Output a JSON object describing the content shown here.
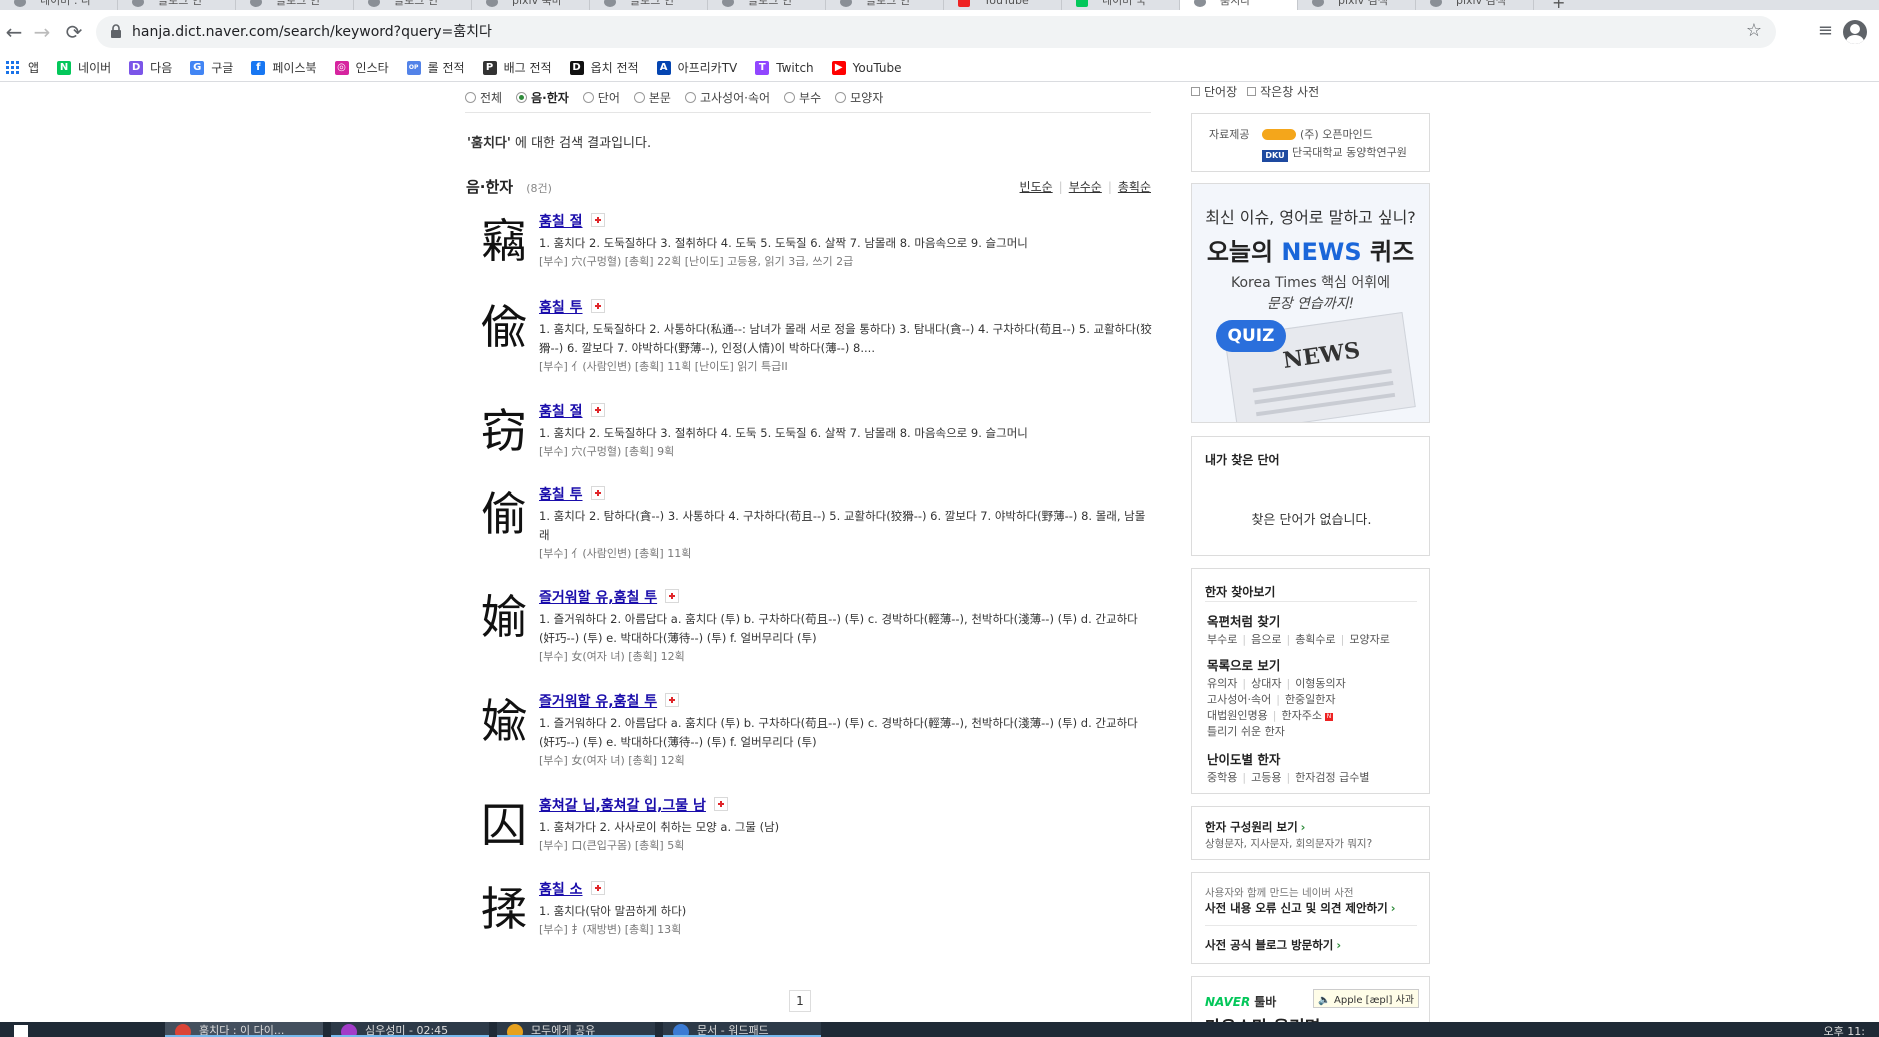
{
  "browser": {
    "tabs": [
      {
        "title": "네이버 : 나",
        "state": "normal"
      },
      {
        "title": "블로그 인",
        "state": "normal"
      },
      {
        "title": "블로그 인",
        "state": "normal"
      },
      {
        "title": "블로그 인",
        "state": "normal"
      },
      {
        "title": "pixiv 북마",
        "state": "normal"
      },
      {
        "title": "블로그 인",
        "state": "normal"
      },
      {
        "title": "블로그 인",
        "state": "normal"
      },
      {
        "title": "블로그 인",
        "state": "normal"
      },
      {
        "title": "YouTube",
        "state": "red"
      },
      {
        "title": "네이버 국",
        "state": "green"
      },
      {
        "title": "훔치다",
        "state": "active"
      },
      {
        "title": "pixiv 검색",
        "state": "normal"
      },
      {
        "title": "pixiv 검색",
        "state": "normal"
      }
    ],
    "url": "hanja.dict.naver.com/search/keyword?query=훔치다",
    "bookmarks": [
      {
        "label": "앱",
        "icon": "apps-grid-icon",
        "color": "#1a73e8"
      },
      {
        "label": "네이버",
        "icon": "naver-icon",
        "color": "#03c75a",
        "glyph": "N"
      },
      {
        "label": "다음",
        "icon": "daum-icon",
        "color": "#7b55e8",
        "glyph": "D"
      },
      {
        "label": "구글",
        "icon": "google-icon",
        "color": "#4285f4",
        "glyph": "G"
      },
      {
        "label": "페이스북",
        "icon": "facebook-icon",
        "color": "#1877f2",
        "glyph": "f"
      },
      {
        "label": "인스타",
        "icon": "instagram-icon",
        "color": "#d6249f",
        "glyph": "◎"
      },
      {
        "label": "롤 전적",
        "icon": "op-gg-icon",
        "color": "#5383e8",
        "glyph": "OP"
      },
      {
        "label": "배그 전적",
        "icon": "pubg-icon",
        "color": "#333333",
        "glyph": "P"
      },
      {
        "label": "옵치 전적",
        "icon": "overwatch-icon",
        "color": "#111111",
        "glyph": "D"
      },
      {
        "label": "아프리카TV",
        "icon": "afreecatv-icon",
        "color": "#0545b1",
        "glyph": "A"
      },
      {
        "label": "Twitch",
        "icon": "twitch-icon",
        "color": "#9146ff",
        "glyph": "T"
      },
      {
        "label": "YouTube",
        "icon": "youtube-icon",
        "color": "#ff0000",
        "glyph": "▶"
      }
    ]
  },
  "filters": [
    {
      "label": "전체",
      "selected": false
    },
    {
      "label": "음·한자",
      "selected": true
    },
    {
      "label": "단어",
      "selected": false
    },
    {
      "label": "본문",
      "selected": false
    },
    {
      "label": "고사성어·속어",
      "selected": false
    },
    {
      "label": "부수",
      "selected": false
    },
    {
      "label": "모양자",
      "selected": false
    }
  ],
  "summary": {
    "query": "'훔치다'",
    "suffix": " 에 대한 검색 결과입니다."
  },
  "section": {
    "title": "음·한자",
    "count": "(8건)",
    "sorts": [
      "빈도순",
      "부수순",
      "총획순"
    ]
  },
  "entries": [
    {
      "char": "竊",
      "head": "훔칠 절",
      "mean": "1. 훔치다 2. 도둑질하다 3. 절취하다 4. 도둑 5. 도둑질 6. 살짝 7. 남몰래 8. 마음속으로 9. 슬그머니",
      "meta": "[부수] 穴(구멍혈)  [총획] 22획  [난이도] 고등용, 읽기 3급, 쓰기 2급"
    },
    {
      "char": "偸",
      "head": "훔칠 투",
      "mean": "1. 훔치다, 도둑질하다 2. 사통하다(私通--: 남녀가 몰래 서로 정을 통하다) 3. 탐내다(貪--) 4. 구차하다(苟且--) 5. 교활하다(狡猾--) 6. 깔보다 7. 야박하다(野薄--), 인정(人情)이 박하다(薄--) 8....",
      "meta": "[부수] 亻(사람인변)  [총획] 11획  [난이도] 읽기 특급II"
    },
    {
      "char": "窃",
      "head": "훔칠 절",
      "mean": "1. 훔치다 2. 도둑질하다 3. 절취하다 4. 도둑 5. 도둑질 6. 살짝 7. 남몰래 8. 마음속으로 9. 슬그머니",
      "meta": "[부수] 穴(구멍혈)  [총획] 9획"
    },
    {
      "char": "偷",
      "head": "훔칠 투",
      "mean": "1. 훔치다 2. 탐하다(貪--) 3. 사통하다 4. 구차하다(苟且--) 5. 교활하다(狡猾--) 6. 깔보다 7. 야박하다(野薄--) 8. 몰래, 남몰래",
      "meta": "[부수] 亻(사람인변)  [총획] 11획"
    },
    {
      "char": "媮",
      "head": "즐거워할 유,훔칠 투",
      "mean": "1. 즐거워하다 2. 아름답다 a. 훔치다 (투) b. 구차하다(苟且--) (투) c. 경박하다(輕薄--), 천박하다(淺薄--) (투) d. 간교하다(奸巧--) (투) e. 박대하다(薄待--) (투) f. 얼버무리다 (투)",
      "meta": "[부수] 女(여자 녀)  [총획] 12획"
    },
    {
      "char": "婾",
      "head": "즐거워할 유,훔칠 투",
      "mean": "1. 즐거워하다 2. 아름답다 a. 훔치다 (투) b. 구차하다(苟且--) (투) c. 경박하다(輕薄--), 천박하다(淺薄--) (투) d. 간교하다(奸巧--) (투) e. 박대하다(薄待--) (투) f. 얼버무리다 (투)",
      "meta": "[부수] 女(여자 녀)  [총획] 12획"
    },
    {
      "char": "囚",
      "head": "훔쳐갈 닙,훔쳐갈 입,그물 남",
      "mean": "1. 훔쳐가다 2. 사사로이 취하는 모양 a. 그물 (남)",
      "meta": "[부수] 口(큰입구몸)  [총획] 5획"
    },
    {
      "char": "揉",
      "head": "훔칠 소",
      "mean": "1. 훔치다(닦아 말끔하게 하다)",
      "meta": "[부수] 扌(재방변)  [총획] 13획"
    }
  ],
  "pager": {
    "current": "1"
  },
  "right": {
    "top_links": [
      "단어장",
      "작은창 사전"
    ],
    "provider": {
      "label": "자료제공",
      "p1": "(주) 오픈마인드",
      "p1_logo": "hanja",
      "p2": "단국대학교 동양학연구원",
      "p2_logo": "DKU"
    },
    "ad": {
      "line1": "최신 이슈, 영어로 말하고 싶니?",
      "line2a": "오늘의 ",
      "line2b": "NEWS",
      "line2c": " 퀴즈",
      "line3": "Korea Times 핵심 어휘에",
      "line4": "문장 연습까지!",
      "quiz": "QUIZ",
      "paper": "NEWS"
    },
    "recent": {
      "title": "내가 찾은 단어",
      "empty": "찾은 단어가 없습니다."
    },
    "finder": {
      "title": "한자 찾아보기",
      "g1": {
        "title": "옥편처럼 찾기",
        "items": [
          "부수로",
          "음으로",
          "총획수로",
          "모양자로"
        ]
      },
      "g2": {
        "title": "목록으로 보기",
        "row1": [
          "유의자",
          "상대자",
          "이형동의자"
        ],
        "row2": [
          "고사성어·속어",
          "한중일한자"
        ],
        "row3": [
          "대법원인명용",
          "한자주소"
        ],
        "row4": [
          "틀리기 쉬운 한자"
        ],
        "new": "N"
      },
      "g3": {
        "title": "난이도별 한자",
        "items": [
          "중학용",
          "고등용",
          "한자검정 급수별"
        ]
      }
    },
    "principle": {
      "title": "한자 구성원리 보기",
      "desc": "상형문자, 지사문자, 회의문자가 뭐지?"
    },
    "report": {
      "small": "사용자와 함께 만드는 네이버 사전",
      "link1": "사전 내용 오류 신고 및 의견 제안하기",
      "link2": "사전 공식 블로그 방문하기"
    },
    "toolbar_ad": {
      "brand": "NAVER",
      "label": "툴바",
      "headline": "마우스만 올리면",
      "tip": "🔈 Apple [æpl] 사과"
    }
  },
  "taskbar": {
    "items": [
      {
        "title": "훔치다 : 이 다이...",
        "color": "#db4437"
      },
      {
        "title": "심우성미 - 02:45",
        "color": "#a23cc9"
      },
      {
        "title": "모두에게 공유",
        "color": "#e6a11e"
      },
      {
        "title": "문서 - 워드패드",
        "color": "#3b7bd4"
      }
    ],
    "clock": "오후 11:"
  }
}
